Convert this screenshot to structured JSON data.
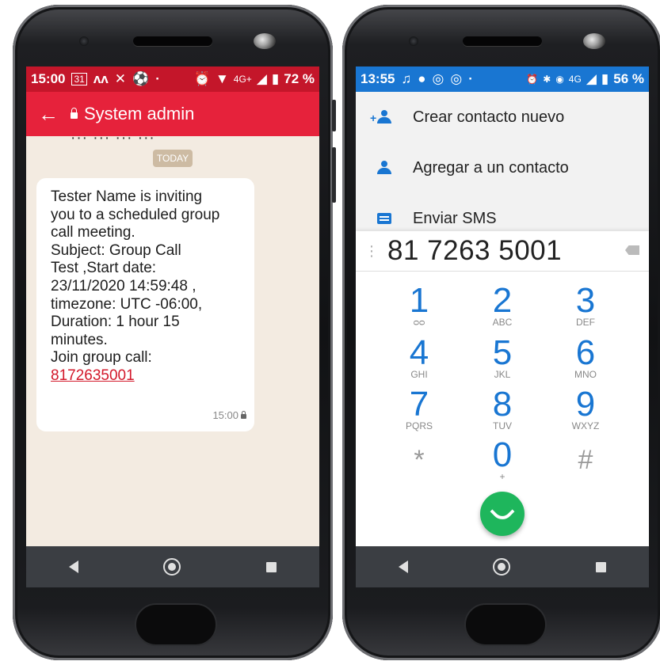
{
  "left_phone": {
    "status": {
      "time": "15:00",
      "calendar_day": "31",
      "battery": "72 %",
      "network": "4G+"
    },
    "appbar": {
      "title": "System admin"
    },
    "chat": {
      "partial_text": "··· ··· ··· ···",
      "date_pill": "TODAY",
      "message_lines": [
        "Tester Name is inviting",
        "you to a scheduled group",
        "call meeting.",
        "Subject: Group Call",
        "Test ,Start date:",
        "23/11/2020 14:59:48 ,",
        "timezone: UTC -06:00,",
        "Duration: 1 hour 15",
        "minutes.",
        "Join group call:"
      ],
      "link": "8172635001",
      "timestamp": "15:00"
    }
  },
  "right_phone": {
    "status": {
      "time": "13:55",
      "battery": "56 %",
      "network": "4G"
    },
    "menu": [
      {
        "label": "Crear contacto nuevo",
        "icon": "add-person-icon"
      },
      {
        "label": "Agregar a un contacto",
        "icon": "person-icon"
      },
      {
        "label": "Enviar SMS",
        "icon": "message-icon"
      }
    ],
    "dialer": {
      "number": "81 7263 5001",
      "keys": [
        {
          "digit": "1",
          "letters": "ᴑᴑ"
        },
        {
          "digit": "2",
          "letters": "ABC"
        },
        {
          "digit": "3",
          "letters": "DEF"
        },
        {
          "digit": "4",
          "letters": "GHI"
        },
        {
          "digit": "5",
          "letters": "JKL"
        },
        {
          "digit": "6",
          "letters": "MNO"
        },
        {
          "digit": "7",
          "letters": "PQRS"
        },
        {
          "digit": "8",
          "letters": "TUV"
        },
        {
          "digit": "9",
          "letters": "WXYZ"
        },
        {
          "digit": "*",
          "letters": ""
        },
        {
          "digit": "0",
          "letters": "+"
        },
        {
          "digit": "#",
          "letters": ""
        }
      ]
    }
  },
  "colors": {
    "left_status": "#c4162a",
    "left_appbar": "#e6223b",
    "right_status": "#1976d2",
    "call_green": "#1eb65c"
  }
}
